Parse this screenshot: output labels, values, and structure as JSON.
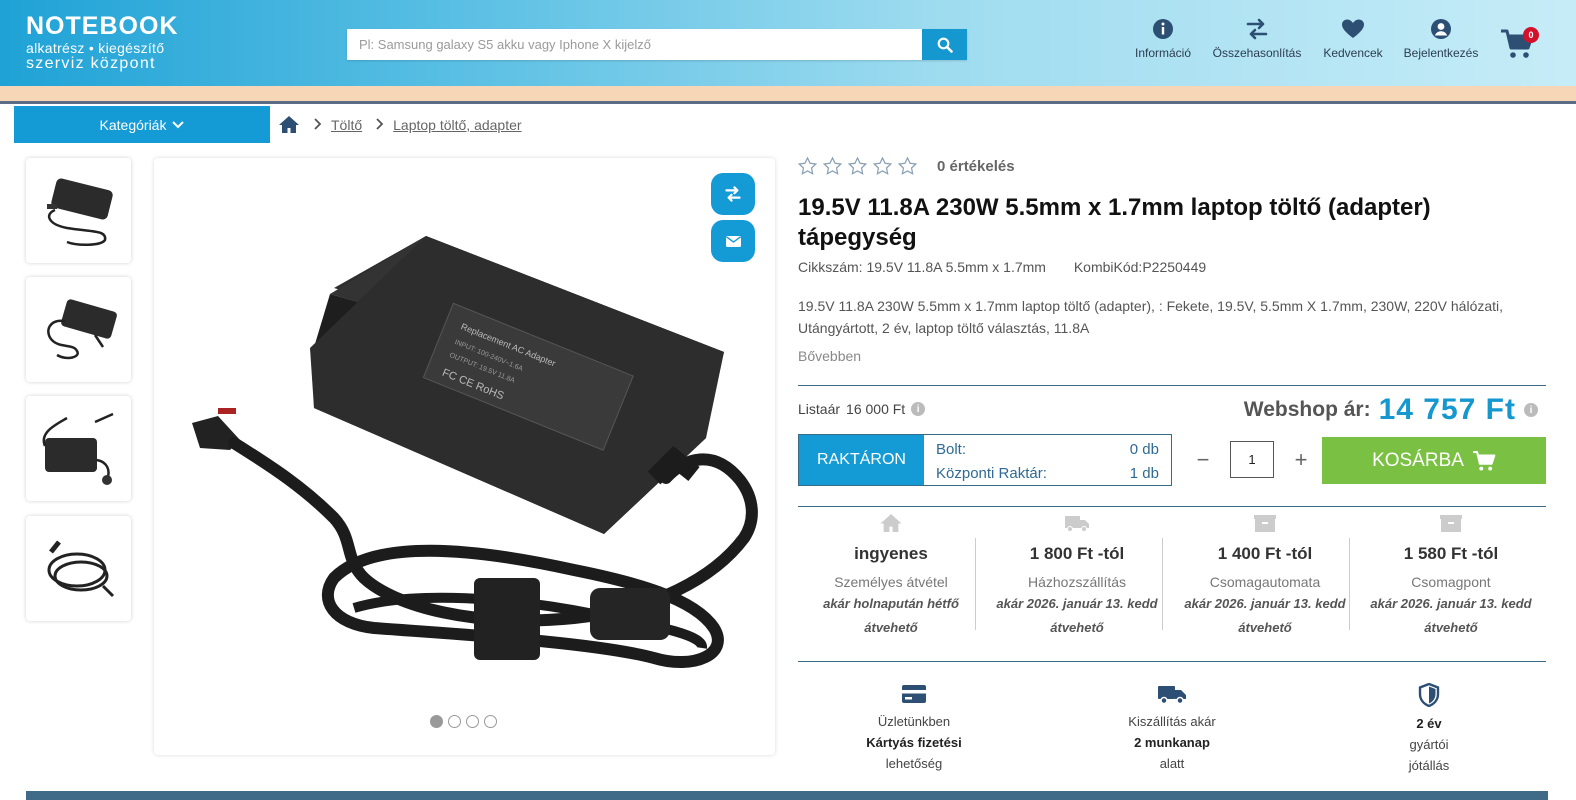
{
  "header": {
    "logo": {
      "line1": "NOTEBOOK",
      "line2": "alkatrész • kiegészítő",
      "line3": "szerviz központ"
    },
    "search": {
      "placeholder": "Pl: Samsung galaxy S5 akku vagy Iphone X kijelző"
    },
    "nav": [
      {
        "label": "Információ",
        "icon": "info-icon"
      },
      {
        "label": "Összehasonlítás",
        "icon": "compare-icon"
      },
      {
        "label": "Kedvencek",
        "icon": "heart-icon"
      },
      {
        "label": "Bejelentkezés",
        "icon": "user-icon"
      }
    ],
    "cart": {
      "count": "0",
      "icon": "cart-icon"
    }
  },
  "categories": {
    "label": "Kategóriák"
  },
  "breadcrumb": [
    "Töltő",
    "Laptop töltő, adapter"
  ],
  "gallery": {
    "thumb_count": 4,
    "dots_total": 4,
    "dots_active": 1
  },
  "product": {
    "rating_count": "0 értékelés",
    "stars": 0,
    "title": "19.5V 11.8A 230W 5.5mm x 1.7mm laptop töltő (adapter) tápegység",
    "sku": "Cikkszám: 19.5V 11.8A 5.5mm x 1.7mm",
    "kombi": "KombiKód:P2250449",
    "description": "19.5V 11.8A 230W 5.5mm x 1.7mm laptop töltő (adapter), : Fekete, 19.5V, 5.5mm X 1.7mm, 230W, 220V hálózati, Utángyártott, 2 év, laptop töltő választás, 11.8A",
    "more": "Bővebben",
    "list_price_label": "Listaár",
    "list_price": "16 000 Ft",
    "webshop_label": "Webshop ár:",
    "webshop_price": "14 757 Ft",
    "stock_status": "RAKTÁRON",
    "stock": [
      {
        "label": "Bolt:",
        "value": "0 db"
      },
      {
        "label": "Központi Raktár:",
        "value": "1 db"
      }
    ],
    "quantity": "1",
    "add_to_cart": "KOSÁRBA"
  },
  "shipping": [
    {
      "head": "ingyenes",
      "sub": "Személyes átvétel",
      "date1": "akár holnapután hétfő",
      "date2": "átvehető",
      "icon": "home-icon"
    },
    {
      "head": "1 800 Ft -tól",
      "sub": "Házhozszállítás",
      "date1": "akár 2026. január 13. kedd",
      "date2": "átvehető",
      "icon": "truck-icon"
    },
    {
      "head": "1 400 Ft -tól",
      "sub": "Csomagautomata",
      "date1": "akár 2026. január 13. kedd",
      "date2": "átvehető",
      "icon": "box-icon"
    },
    {
      "head": "1 580 Ft -tól",
      "sub": "Csomagpont",
      "date1": "akár 2026. január 13. kedd",
      "date2": "átvehető",
      "icon": "box-icon"
    }
  ],
  "features": [
    {
      "l1": "Üzletünkben",
      "l2": "Kártyás fizetési",
      "l3": "lehetőség",
      "icon": "credit-card-icon"
    },
    {
      "l1": "Kiszállítás akár",
      "l2": "2 munkanap",
      "l3": "alatt",
      "icon": "delivery-truck-icon"
    },
    {
      "l1": "2 év",
      "l2": "gyártói",
      "l3": "jótállás",
      "icon": "shield-icon"
    }
  ],
  "colors": {
    "brand": "#149bd6",
    "cart_green": "#7ac143",
    "price_blue": "#1597cf",
    "badge_red": "#d3112a"
  }
}
